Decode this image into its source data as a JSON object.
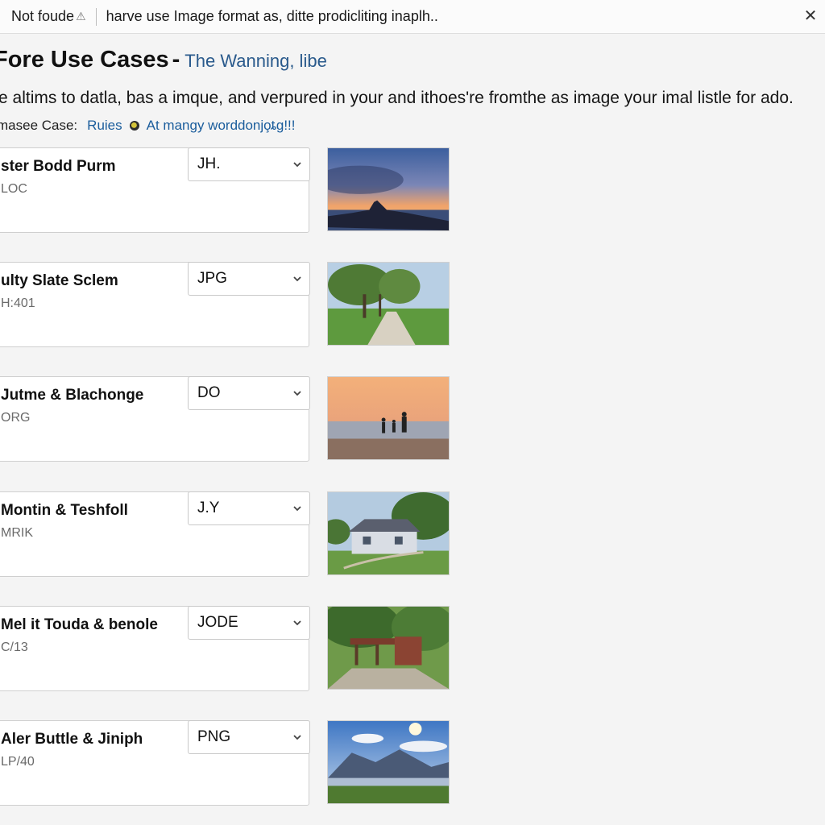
{
  "notification": {
    "status": "Not foude",
    "status_icon": "warning-icon",
    "message": "harve use Image format as, ditte prodicliting inaplh..",
    "close_icon": "close-icon"
  },
  "header": {
    "title": "Fore Use Cases",
    "separator": "-",
    "subtitle": "The Wanning, libe"
  },
  "intro": "e altims to datla, bas a imque, and verpured in your and ithoes're fromthe as image your imal listle for ado.",
  "case_row": {
    "label": "masee Case:",
    "rules_link": "Ruies",
    "mangy_link": "At mangy worddonjo̧ȶg!!!",
    "dot_icon": "status-dot-icon"
  },
  "items": [
    {
      "title": "ster Bodd Purm",
      "meta": "LOC",
      "format": "JH.",
      "thumbnail": "sunset-castle-image"
    },
    {
      "title": "ulty Slate Sclem",
      "meta": "H:401",
      "format": "JPG",
      "thumbnail": "park-path-image"
    },
    {
      "title": "Jutme & Blachonge",
      "meta": "ORG",
      "format": "DO",
      "thumbnail": "beach-family-image"
    },
    {
      "title": "Montin & Teshfoll",
      "meta": "MRIK",
      "format": "J.Y",
      "thumbnail": "house-garden-image"
    },
    {
      "title": "Mel it Touda & benole",
      "meta": "C/13",
      "format": "JODE",
      "thumbnail": "garden-pavilion-image"
    },
    {
      "title": "Aler Buttle & Jiniph",
      "meta": "LP/40",
      "format": "PNG",
      "thumbnail": "mountain-lake-image"
    }
  ],
  "colors": {
    "link": "#1b5d9c",
    "subtitle": "#2a5a8c",
    "page_background": "#f4f4f4"
  }
}
